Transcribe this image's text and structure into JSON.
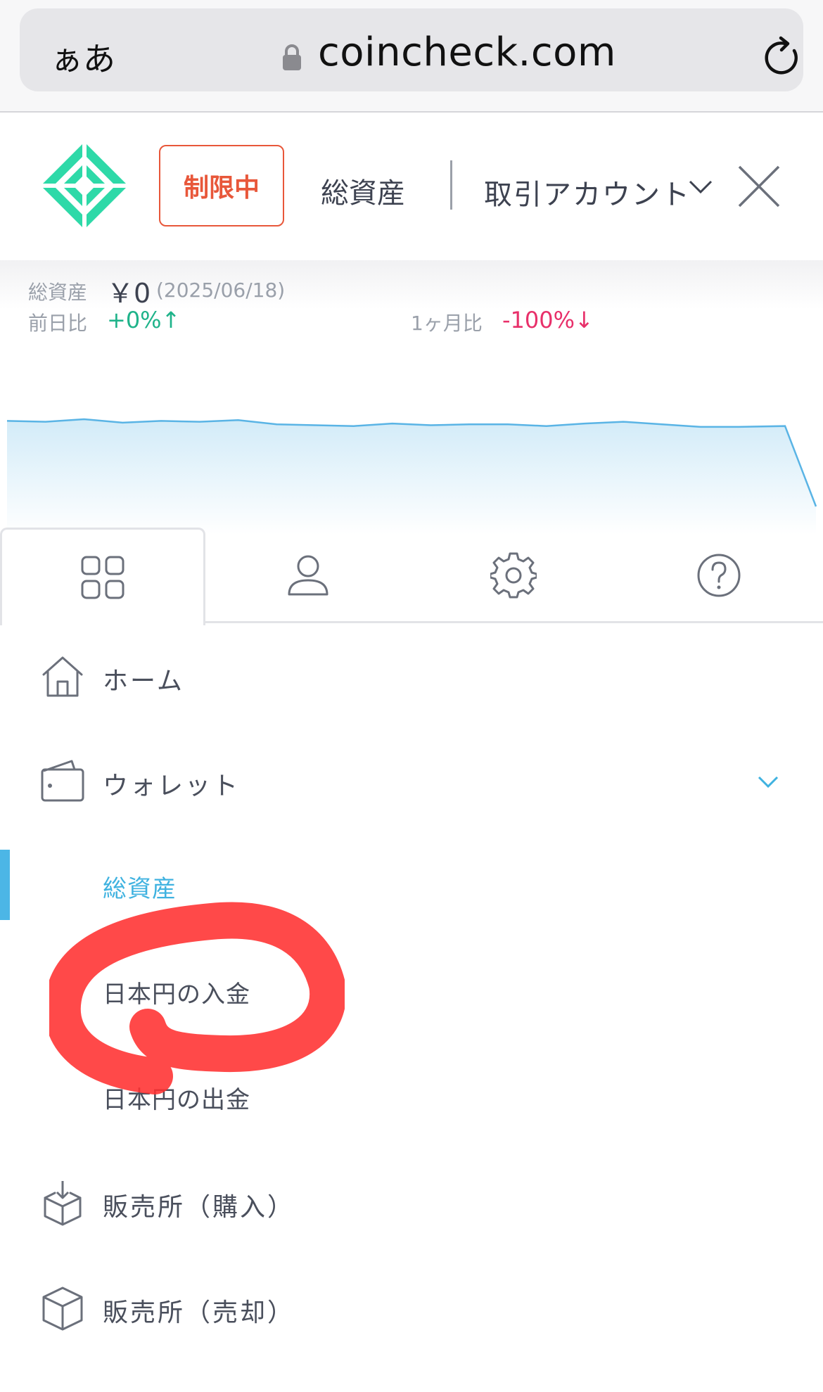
{
  "browser": {
    "text_size_label": "ぁあ",
    "url": "coincheck.com"
  },
  "header": {
    "badge": "制限中",
    "total_assets": "総資産",
    "account_selector": "取引アカウント"
  },
  "summary": {
    "total_label": "総資産",
    "total_value": "￥0",
    "date": "(2025/06/18)",
    "day_label": "前日比",
    "day_change": "+0%↑",
    "month_label": "1ヶ月比",
    "month_change": "-100%↓"
  },
  "chart_data": {
    "type": "area",
    "values": [
      100,
      99,
      102,
      98,
      100,
      99,
      101,
      96,
      95,
      94,
      97,
      95,
      96,
      96,
      94,
      97,
      99,
      96,
      93,
      93,
      94,
      0
    ],
    "colors": {
      "line": "#5ab4e5",
      "fill_top": "#d2ebf8"
    }
  },
  "tabs": [
    {
      "name": "dashboard",
      "icon": "grid-icon"
    },
    {
      "name": "account",
      "icon": "user-icon"
    },
    {
      "name": "settings",
      "icon": "gear-icon"
    },
    {
      "name": "help",
      "icon": "help-icon"
    }
  ],
  "menu": {
    "home": "ホーム",
    "wallet": "ウォレット",
    "wallet_sub": [
      "総資産",
      "日本円の入金",
      "日本円の出金"
    ],
    "buy": "販売所（購入）",
    "sell": "販売所（売却）"
  },
  "colors": {
    "brand": "#2ed9a8",
    "badge": "#e8573a",
    "positive": "#1fb38a",
    "negative": "#e8306a",
    "active": "#3fb2e0",
    "annotation": "#ff3030"
  }
}
